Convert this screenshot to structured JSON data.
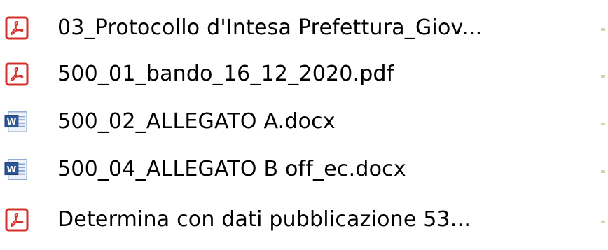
{
  "files": [
    {
      "name": "03_Protocollo d'Intesa Prefettura_Giov...",
      "type": "pdf",
      "icon": "pdf-icon"
    },
    {
      "name": "500_01_bando_16_12_2020.pdf",
      "type": "pdf",
      "icon": "pdf-icon"
    },
    {
      "name": "500_02_ALLEGATO A.docx",
      "type": "docx",
      "icon": "word-icon"
    },
    {
      "name": "500_04_ALLEGATO B off_ec.docx",
      "type": "docx",
      "icon": "word-icon"
    },
    {
      "name": "Determina con dati pubblicazione 53...",
      "type": "pdf",
      "icon": "pdf-icon"
    }
  ],
  "colors": {
    "pdf_red": "#d4302b",
    "word_blue": "#2b5797"
  }
}
